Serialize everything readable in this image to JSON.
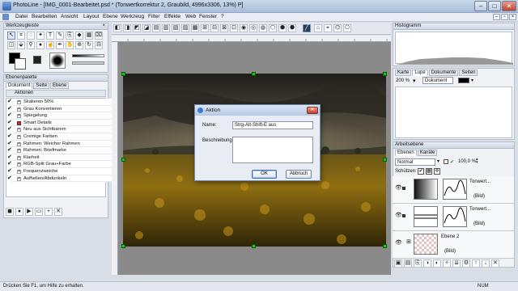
{
  "window": {
    "title": "PhotoLine - [IMG_0001-Bearbeitet.psd * (Tonwertkorrektur 2, Graubild, 4996x3306, 13%) P]",
    "min": "–",
    "max": "□",
    "close": "✕"
  },
  "menu": [
    "Datei",
    "Bearbeiten",
    "Ansicht",
    "Layout",
    "Ebene",
    "Werkzeug",
    "Filter",
    "Effekte",
    "Web",
    "Fenster",
    "?"
  ],
  "toolbox": {
    "title": "Werkzeugleiste",
    "close": "×"
  },
  "layer_panel_left": {
    "title": "Ebenenpalette",
    "tabs": [
      "Dokument",
      "Seite",
      "Ebene"
    ],
    "actions_header": "Aktionen",
    "actions": [
      "Skalieren 50%",
      "Grau Konvertieren",
      "Spiegelung",
      "Smart Details",
      "Neu aus Sichtbarem",
      "Cremige Farben",
      "Rahmen: Weicher Rahmen",
      "Rahmen: Briefmarke",
      "Klarheit",
      "RGB-Split Grau+Farbe",
      "Frequenzweiche",
      "Aufhellen/Abdunkeln"
    ]
  },
  "dialog": {
    "title": "Aktion",
    "name_label": "Name:",
    "name_value": "Strg-Alt-Shift-E aus",
    "desc_label": "Beschreibung:",
    "ok": "OK",
    "cancel": "Abbruch",
    "close": "✕"
  },
  "histogram": {
    "title": "Histogramm"
  },
  "nav_panel": {
    "tabs": [
      "Karte",
      "Lupe",
      "Dokumente",
      "Seiten"
    ],
    "zoom": "200 %",
    "mode": "Dokument"
  },
  "layers": {
    "title": "Arbeitsebene",
    "tabs": [
      "Ebenen",
      "Kanäle"
    ],
    "blend_mode": "Normal",
    "opacity": "100,0 %",
    "protect_label": "Schützen:",
    "items": [
      {
        "name": "Tonwert...",
        "sub": "(Bild)"
      },
      {
        "name": "Tonwert...",
        "sub": "(Bild)"
      },
      {
        "name": "Ebene 2",
        "sub": "(Bild)"
      }
    ]
  },
  "status": {
    "help": "Drücken Sie F1, um Hilfe zu erhalten.",
    "num": "NUM"
  },
  "colors": {
    "handle": "#15c815",
    "titlebar": "#b5c9e3"
  }
}
